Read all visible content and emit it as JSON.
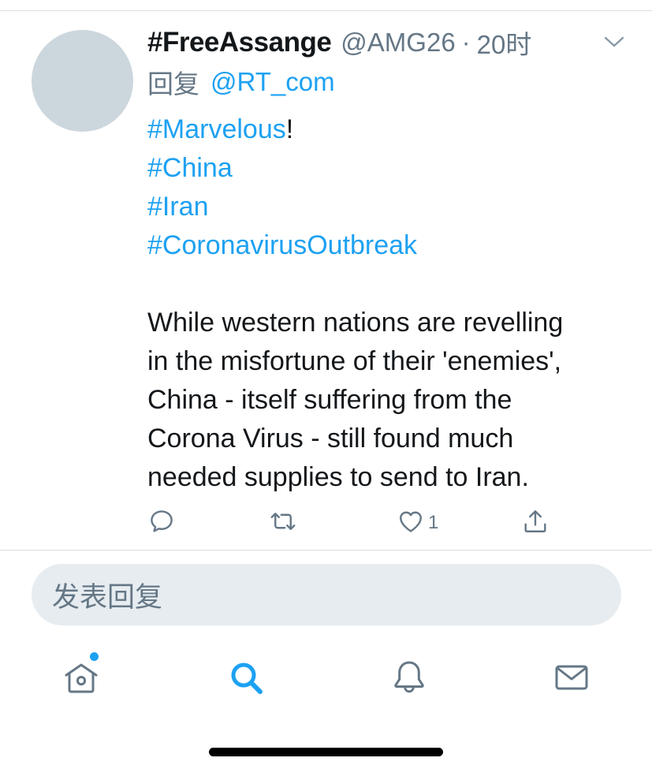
{
  "tweet": {
    "display_name": "#FreeAssange",
    "handle": "@AMG26",
    "separator": "·",
    "time": "20时",
    "reply_label": "回复",
    "reply_to": "@RT_com",
    "hashtag_marvelous": "#Marvelous",
    "exclamation": "!",
    "hashtag_china": "#China",
    "hashtag_iran": "#Iran",
    "hashtag_coronavirus": "#CoronavirusOutbreak",
    "body_lines": [
      "While western nations are revelling",
      "in the misfortune of their 'enemies',",
      "China - itself suffering from the",
      "Corona Virus - still found much",
      "needed supplies to send to Iran."
    ],
    "like_count": "1"
  },
  "composer": {
    "placeholder": "发表回复"
  },
  "icons": {
    "menu": "chevron-down-icon",
    "reply": "comment-icon",
    "retweet": "retweet-icon",
    "like": "heart-icon",
    "share": "share-icon",
    "home": "home-icon",
    "search": "search-icon",
    "notifications": "bell-icon",
    "messages": "envelope-icon"
  },
  "colors": {
    "accent": "#1da1f2",
    "secondary_text": "#657786",
    "primary_text": "#14171a",
    "avatar_placeholder": "#ccd6dd",
    "composer_background": "#e6ecf0"
  },
  "tabbar": {
    "active_tab": "search",
    "home_has_new": true
  }
}
